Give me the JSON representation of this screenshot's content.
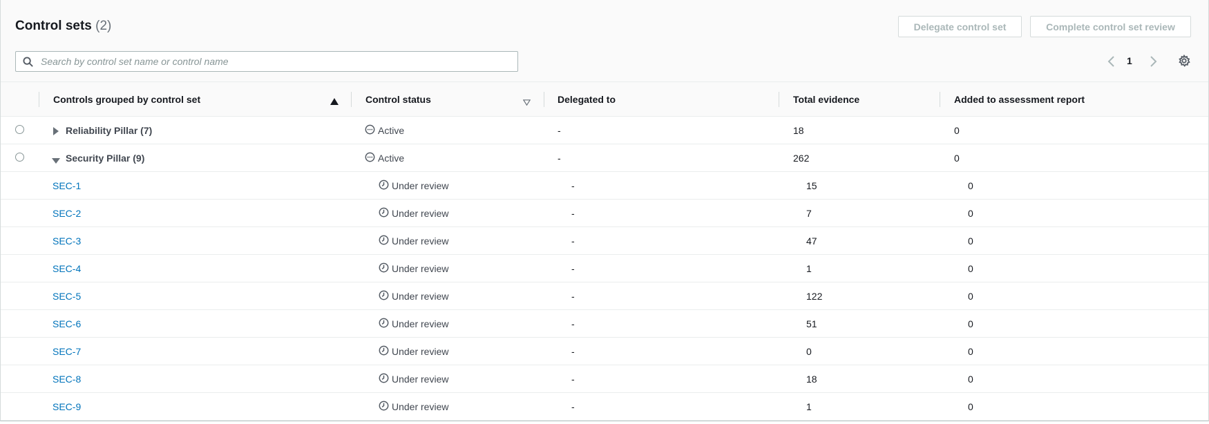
{
  "header": {
    "title": "Control sets",
    "count": "(2)",
    "delegate_button": "Delegate control set",
    "complete_button": "Complete control set review"
  },
  "search": {
    "placeholder": "Search by control set name or control name"
  },
  "pagination": {
    "current_page": "1"
  },
  "table": {
    "columns": [
      "Controls grouped by control set",
      "Control status",
      "Delegated to",
      "Total evidence",
      "Added to assessment report"
    ],
    "groups": [
      {
        "name": "Reliability Pillar (7)",
        "expanded": false,
        "status": "Active",
        "delegated": "-",
        "evidence": "18",
        "report": "0"
      },
      {
        "name": "Security Pillar (9)",
        "expanded": true,
        "status": "Active",
        "delegated": "-",
        "evidence": "262",
        "report": "0"
      }
    ],
    "controls": [
      {
        "name": "SEC-1",
        "status": "Under review",
        "delegated": "-",
        "evidence": "15",
        "report": "0"
      },
      {
        "name": "SEC-2",
        "status": "Under review",
        "delegated": "-",
        "evidence": "7",
        "report": "0"
      },
      {
        "name": "SEC-3",
        "status": "Under review",
        "delegated": "-",
        "evidence": "47",
        "report": "0"
      },
      {
        "name": "SEC-4",
        "status": "Under review",
        "delegated": "-",
        "evidence": "1",
        "report": "0"
      },
      {
        "name": "SEC-5",
        "status": "Under review",
        "delegated": "-",
        "evidence": "122",
        "report": "0"
      },
      {
        "name": "SEC-6",
        "status": "Under review",
        "delegated": "-",
        "evidence": "51",
        "report": "0"
      },
      {
        "name": "SEC-7",
        "status": "Under review",
        "delegated": "-",
        "evidence": "0",
        "report": "0"
      },
      {
        "name": "SEC-8",
        "status": "Under review",
        "delegated": "-",
        "evidence": "18",
        "report": "0"
      },
      {
        "name": "SEC-9",
        "status": "Under review",
        "delegated": "-",
        "evidence": "1",
        "report": "0"
      }
    ]
  },
  "colors": {
    "link": "#0073bb",
    "text": "#16191f",
    "muted": "#687078",
    "disabled_button_text": "#aab7b8"
  },
  "icons": {
    "search": "search-icon",
    "prev": "chevron-left-icon",
    "next": "chevron-right-icon",
    "settings": "gear-icon",
    "sort_asc": "sort-ascending-icon",
    "sort_none": "sort-descending-outline-icon",
    "active_status": "ellipsis-circle-icon",
    "review_status": "clock-icon",
    "collapsed": "caret-right-icon",
    "expanded": "caret-down-icon"
  }
}
